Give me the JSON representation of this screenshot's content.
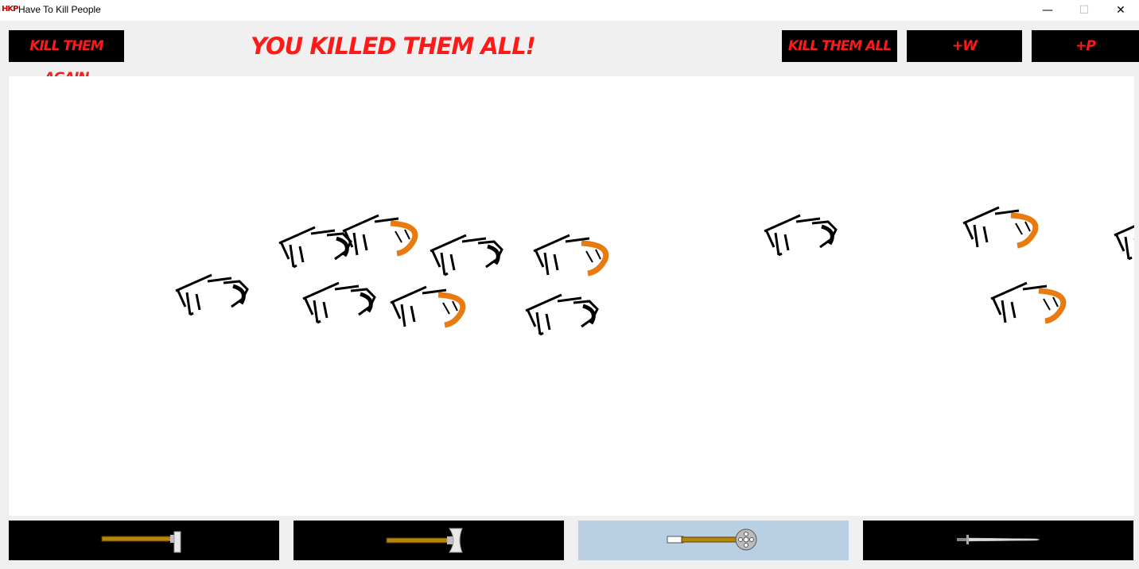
{
  "window": {
    "icon_text": "HKP",
    "title": "Have To Kill People",
    "minimize_glyph": "—",
    "maximize_glyph": "☐",
    "close_glyph": "✕"
  },
  "toolbar": {
    "kill_again_label": "KILL THEM AGAIN",
    "headline": "YOU KILLED THEM ALL!",
    "kill_all_label": "KILL THEM ALL",
    "add_w_label": "+W",
    "add_p_label": "+P"
  },
  "colors": {
    "accent_red": "#ff1a1a",
    "selected_weapon_bg": "#b9cfe4",
    "blood_orange": "#e87a10"
  },
  "weapons": [
    {
      "name": "axe-icon",
      "selected": false
    },
    {
      "name": "battle-axe-icon",
      "selected": false
    },
    {
      "name": "mace-icon",
      "selected": true
    },
    {
      "name": "sword-icon",
      "selected": false
    }
  ]
}
